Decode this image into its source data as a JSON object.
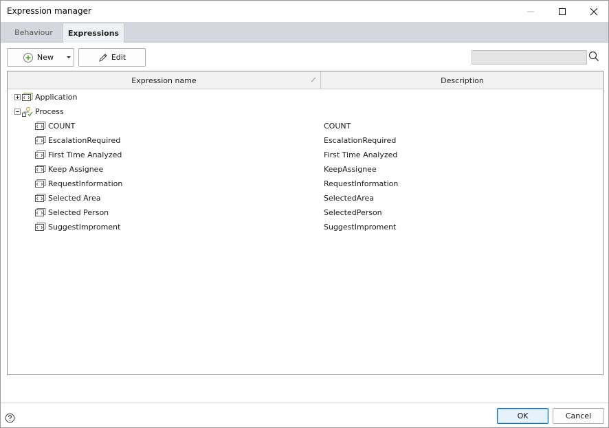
{
  "window": {
    "title": "Expression manager"
  },
  "tabs": [
    {
      "label": "Behaviour",
      "active": false
    },
    {
      "label": "Expressions",
      "active": true
    }
  ],
  "toolbar": {
    "new_label": "New",
    "edit_label": "Edit",
    "search_value": "",
    "search_placeholder": ""
  },
  "grid": {
    "columns": [
      "Expression name",
      "Description"
    ],
    "groups": [
      {
        "name": "Application",
        "expanded": false,
        "icon": "expression-folder-icon"
      },
      {
        "name": "Process",
        "expanded": true,
        "icon": "process-icon"
      }
    ],
    "rows": [
      {
        "name": "COUNT",
        "description": "COUNT"
      },
      {
        "name": "EscalationRequired",
        "description": "EscalationRequired"
      },
      {
        "name": "First Time Analyzed",
        "description": "First Time Analyzed"
      },
      {
        "name": "Keep Assignee",
        "description": "KeepAssignee"
      },
      {
        "name": "RequestInformation",
        "description": "RequestInformation"
      },
      {
        "name": "Selected Area",
        "description": "SelectedArea"
      },
      {
        "name": "Selected Person",
        "description": "SelectedPerson"
      },
      {
        "name": "SuggestImproment",
        "description": "SuggestImproment"
      }
    ]
  },
  "footer": {
    "ok_label": "OK",
    "cancel_label": "Cancel"
  },
  "colors": {
    "tab_strip": "#d4d8de",
    "accent": "#0078d7",
    "new_icon_green": "#5aa02c"
  }
}
